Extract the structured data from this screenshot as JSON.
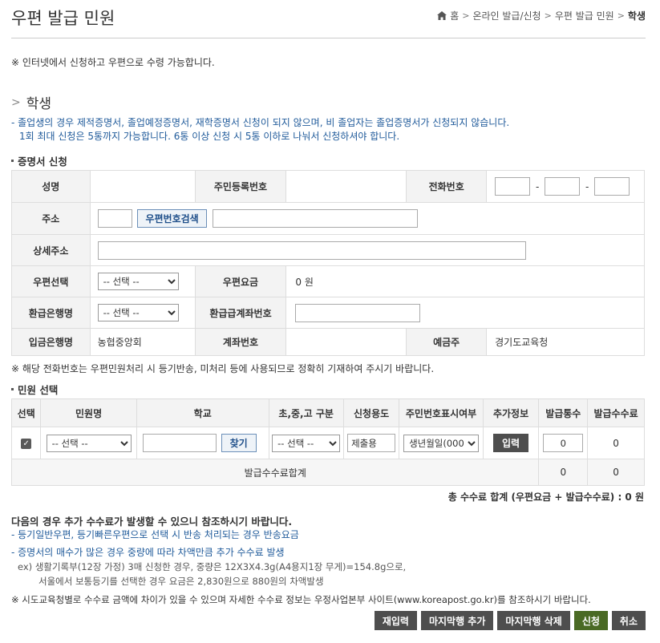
{
  "header": {
    "title": "우편 발급 민원",
    "breadcrumb": [
      "홈",
      "온라인 발급/신청",
      "우편 발급 민원",
      "학생"
    ]
  },
  "top_note": "※ 인터넷에서 신청하고 우편으로 수령 가능합니다.",
  "section": {
    "title": "학생",
    "notes": [
      "- 졸업생의 경우 제적증명서, 졸업예정증명서, 재학증명서 신청이 되지 않으며, 비 졸업자는 졸업증명서가 신청되지 않습니다.",
      "1회 최대 신청은 5통까지 가능합니다. 6통 이상 신청 시 5통 이하로 나눠서 신청하셔야 합니다."
    ]
  },
  "cert_form": {
    "heading": "증명서 신청",
    "labels": {
      "name": "성명",
      "rrn": "주민등록번호",
      "phone": "전화번호",
      "address": "주소",
      "detail_address": "상세주소",
      "post_select": "우편선택",
      "post_fee": "우편요금",
      "refund_bank": "환급은행명",
      "refund_account": "환급급계좌번호",
      "deposit_bank": "입금은행명",
      "account_no": "계좌번호",
      "depositor": "예금주"
    },
    "phone_sep": "-",
    "zip_search_button": "우편번호검색",
    "post_select_value": "-- 선택 --",
    "refund_bank_value": "-- 선택 --",
    "post_fee_value": "0 원",
    "deposit_bank_value": "농협중앙회",
    "depositor_value": "경기도교육청"
  },
  "phone_note": "※ 해당 전화번호는 우편민원처리 시 등기반송, 미처리 등에 사용되므로 정확히 기재하여 주시기 바랍니다.",
  "civil_table": {
    "heading": "민원 선택",
    "columns": [
      "선택",
      "민원명",
      "학교",
      "초,중,고 구분",
      "신청용도",
      "주민번호표시여부",
      "추가정보",
      "발급통수",
      "발급수수료"
    ],
    "row": {
      "checked": true,
      "civil_name": "-- 선택 --",
      "find_button": "찾기",
      "school_level": "-- 선택 --",
      "purpose": "제출용",
      "rrn_display": "생년월일(000",
      "input_button": "입력",
      "count": "0",
      "fee": "0"
    },
    "sum_label": "발급수수료합계",
    "sum_count": "0",
    "sum_fee": "0"
  },
  "total": "총 수수료 합계 (우편요금 + 발급수수료) :  0 원",
  "extra": {
    "title": "다음의 경우 추가 수수료가 발생할 수 있으니 참조하시기 바랍니다.",
    "lines": [
      "- 등기일반우편, 등기빠른우편으로 선택 시 반송 처리되는 경우 반송요금",
      "- 증명서의 매수가 많은 경우 중량에 따라 차액만큼 추가 수수료 발생"
    ],
    "example1": "ex) 생활기록부(12장 가정) 3매 신청한 경우, 중량은 12X3X4.3g(A4용지1장 무게)=154.8g으로,",
    "example2": "서울에서 보통등기를 선택한 경우 요금은 2,830원으로 880원의 차액발생",
    "note": "※ 시도교육청별로 수수료 금액에 차이가 있을 수 있으며 자세한 수수료 정보는 우정사업본부 사이트(www.koreapost.go.kr)를 참조하시기 바랍니다."
  },
  "actions": {
    "reset": "재입력",
    "add_row": "마지막행 추가",
    "delete_row": "마지막행 삭제",
    "submit": "신청",
    "cancel": "취소"
  },
  "colors": {
    "blue_text": "#1f5a9a",
    "header_bg": "#f3f3f3",
    "dark_button": "#4e4e4e",
    "submit_button": "#4a6a24"
  }
}
